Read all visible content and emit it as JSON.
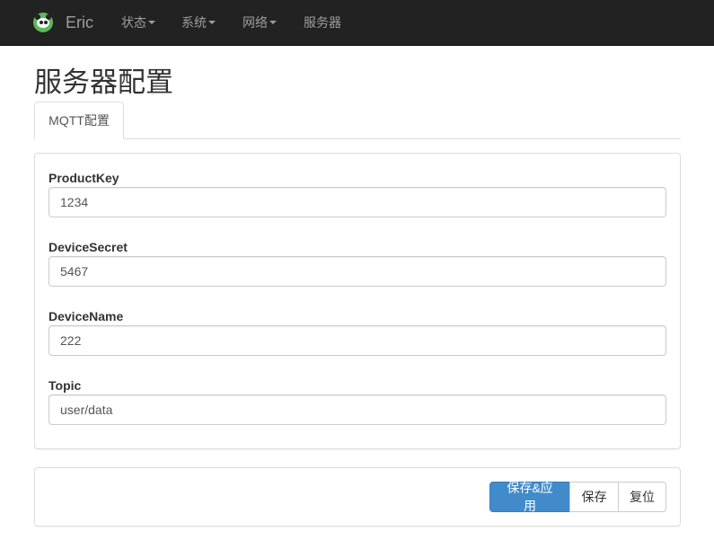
{
  "navbar": {
    "brand": "Eric",
    "items": [
      {
        "label": "状态",
        "dropdown": true
      },
      {
        "label": "系统",
        "dropdown": true
      },
      {
        "label": "网络",
        "dropdown": true
      },
      {
        "label": "服务器",
        "dropdown": false
      }
    ]
  },
  "page": {
    "title": "服务器配置",
    "tabs": [
      {
        "label": "MQTT配置",
        "active": true
      }
    ]
  },
  "form": {
    "fields": [
      {
        "label": "ProductKey",
        "value": "1234"
      },
      {
        "label": "DeviceSecret",
        "value": "5467"
      },
      {
        "label": "DeviceName",
        "value": "222"
      },
      {
        "label": "Topic",
        "value": "user/data"
      }
    ]
  },
  "actions": {
    "save_apply": "保存&应用",
    "save": "保存",
    "reset": "复位"
  },
  "colors": {
    "navbar_bg": "#222222",
    "primary": "#428bca",
    "logo_green": "#5cb85c"
  }
}
